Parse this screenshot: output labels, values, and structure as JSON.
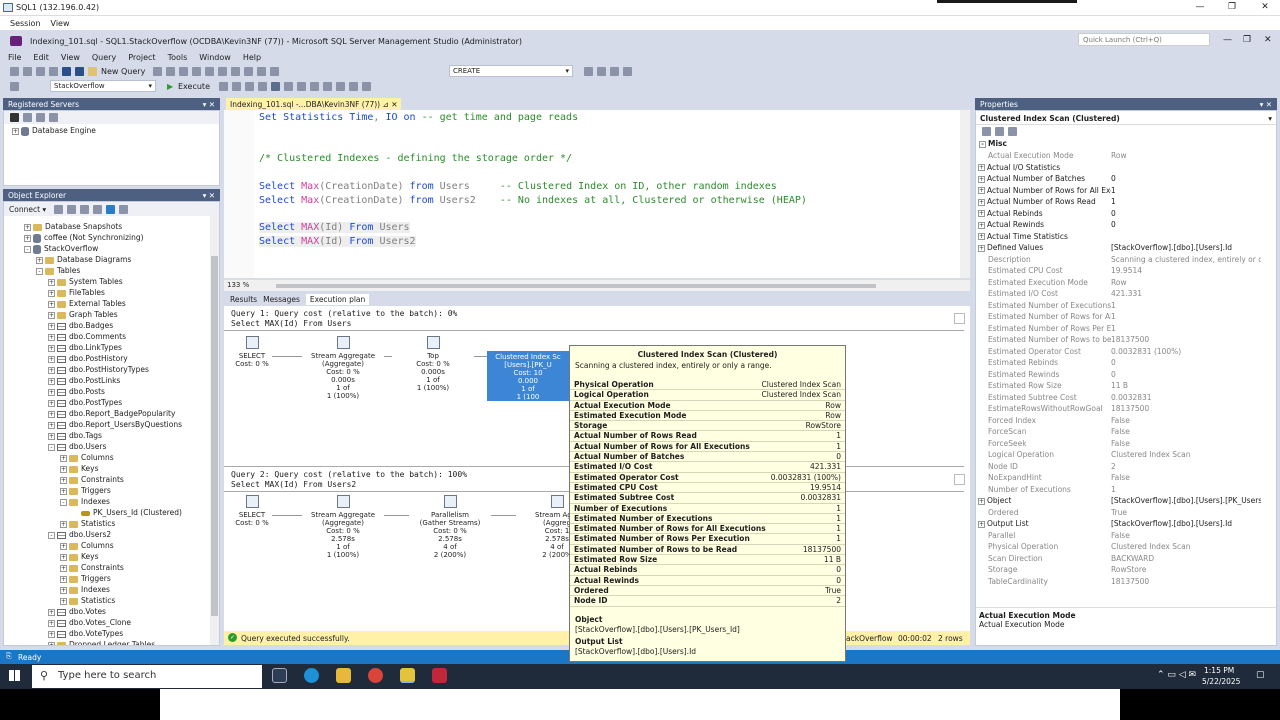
{
  "remote": {
    "title": "SQL1 (132.196.0.42)",
    "menu": [
      "Session",
      "View"
    ],
    "min": "—",
    "max": "❐",
    "close": "✕"
  },
  "ssms": {
    "title": "Indexing_101.sql - SQL1.StackOverflow (OCDBA\\Kevin3NF (77)) - Microsoft SQL Server Management Studio (Administrator)",
    "quick_launch_placeholder": "Quick Launch (Ctrl+Q)",
    "menu": [
      "File",
      "Edit",
      "View",
      "Query",
      "Project",
      "Tools",
      "Window",
      "Help"
    ],
    "new_query": "New Query",
    "execute": "Execute",
    "create_combo": "CREATE",
    "db_combo": "StackOverflow"
  },
  "registered_servers": {
    "header": "Registered Servers",
    "item": "Database Engine"
  },
  "object_explorer": {
    "header": "Object Explorer",
    "connect": "Connect ▾",
    "items": [
      {
        "label": "Database Snapshots",
        "indent": 2,
        "icon": "folder",
        "exp": "+"
      },
      {
        "label": "coffee (Not Synchronizing)",
        "indent": 2,
        "icon": "db",
        "exp": "+"
      },
      {
        "label": "StackOverflow",
        "indent": 2,
        "icon": "db",
        "exp": "-"
      },
      {
        "label": "Database Diagrams",
        "indent": 3,
        "icon": "folder",
        "exp": "+"
      },
      {
        "label": "Tables",
        "indent": 3,
        "icon": "folder",
        "exp": "-"
      },
      {
        "label": "System Tables",
        "indent": 4,
        "icon": "folder",
        "exp": "+"
      },
      {
        "label": "FileTables",
        "indent": 4,
        "icon": "folder",
        "exp": "+"
      },
      {
        "label": "External Tables",
        "indent": 4,
        "icon": "folder",
        "exp": "+"
      },
      {
        "label": "Graph Tables",
        "indent": 4,
        "icon": "folder",
        "exp": "+"
      },
      {
        "label": "dbo.Badges",
        "indent": 4,
        "icon": "table",
        "exp": "+"
      },
      {
        "label": "dbo.Comments",
        "indent": 4,
        "icon": "table",
        "exp": "+"
      },
      {
        "label": "dbo.LinkTypes",
        "indent": 4,
        "icon": "table",
        "exp": "+"
      },
      {
        "label": "dbo.PostHistory",
        "indent": 4,
        "icon": "table",
        "exp": "+"
      },
      {
        "label": "dbo.PostHistoryTypes",
        "indent": 4,
        "icon": "table",
        "exp": "+"
      },
      {
        "label": "dbo.PostLinks",
        "indent": 4,
        "icon": "table",
        "exp": "+"
      },
      {
        "label": "dbo.Posts",
        "indent": 4,
        "icon": "table",
        "exp": "+"
      },
      {
        "label": "dbo.PostTypes",
        "indent": 4,
        "icon": "table",
        "exp": "+"
      },
      {
        "label": "dbo.Report_BadgePopularity",
        "indent": 4,
        "icon": "table",
        "exp": "+"
      },
      {
        "label": "dbo.Report_UsersByQuestions",
        "indent": 4,
        "icon": "table",
        "exp": "+"
      },
      {
        "label": "dbo.Tags",
        "indent": 4,
        "icon": "table",
        "exp": "+"
      },
      {
        "label": "dbo.Users",
        "indent": 4,
        "icon": "table",
        "exp": "-"
      },
      {
        "label": "Columns",
        "indent": 5,
        "icon": "folder",
        "exp": "+"
      },
      {
        "label": "Keys",
        "indent": 5,
        "icon": "folder",
        "exp": "+"
      },
      {
        "label": "Constraints",
        "indent": 5,
        "icon": "folder",
        "exp": "+"
      },
      {
        "label": "Triggers",
        "indent": 5,
        "icon": "folder",
        "exp": "+"
      },
      {
        "label": "Indexes",
        "indent": 5,
        "icon": "folder",
        "exp": "-"
      },
      {
        "label": "PK_Users_Id (Clustered)",
        "indent": 6,
        "icon": "key",
        "exp": ""
      },
      {
        "label": "Statistics",
        "indent": 5,
        "icon": "folder",
        "exp": "+"
      },
      {
        "label": "dbo.Users2",
        "indent": 4,
        "icon": "table",
        "exp": "-"
      },
      {
        "label": "Columns",
        "indent": 5,
        "icon": "folder",
        "exp": "+"
      },
      {
        "label": "Keys",
        "indent": 5,
        "icon": "folder",
        "exp": "+"
      },
      {
        "label": "Constraints",
        "indent": 5,
        "icon": "folder",
        "exp": "+"
      },
      {
        "label": "Triggers",
        "indent": 5,
        "icon": "folder",
        "exp": "+"
      },
      {
        "label": "Indexes",
        "indent": 5,
        "icon": "folder",
        "exp": "+"
      },
      {
        "label": "Statistics",
        "indent": 5,
        "icon": "folder",
        "exp": "+"
      },
      {
        "label": "dbo.Votes",
        "indent": 4,
        "icon": "table",
        "exp": "+"
      },
      {
        "label": "dbo.Votes_Clone",
        "indent": 4,
        "icon": "table",
        "exp": "+"
      },
      {
        "label": "dbo.VoteTypes",
        "indent": 4,
        "icon": "table",
        "exp": "+"
      },
      {
        "label": "Dropped Ledger Tables",
        "indent": 4,
        "icon": "folder",
        "exp": "+"
      }
    ]
  },
  "editor": {
    "tab": "Indexing_101.sql -...DBA\\Kevin3NF (77))",
    "zoom": "133 %",
    "lines": [
      {
        "parts": [
          [
            "kw",
            "Set Statistics Time"
          ],
          [
            "gr",
            ", "
          ],
          [
            "kw",
            "IO on"
          ],
          [
            "cm",
            " -- get time and page reads"
          ]
        ]
      },
      {
        "parts": []
      },
      {
        "parts": []
      },
      {
        "parts": [
          [
            "cm",
            "/* Clustered Indexes - defining the storage order */"
          ]
        ]
      },
      {
        "parts": []
      },
      {
        "parts": [
          [
            "kw",
            "Select "
          ],
          [
            "fn",
            "Max"
          ],
          [
            "gr",
            "(CreationDate) "
          ],
          [
            "kw",
            "from "
          ],
          [
            "gr",
            "Users     "
          ],
          [
            "cm",
            "-- Clustered Index on ID, other random indexes"
          ]
        ]
      },
      {
        "parts": [
          [
            "kw",
            "Select "
          ],
          [
            "fn",
            "Max"
          ],
          [
            "gr",
            "(CreationDate) "
          ],
          [
            "kw",
            "from "
          ],
          [
            "gr",
            "Users2    "
          ],
          [
            "cm",
            "-- No indexes at all, Clustered or otherwise (HEAP)"
          ]
        ]
      },
      {
        "parts": []
      },
      {
        "parts": [
          [
            "kw",
            "Select "
          ],
          [
            "fn",
            "MAX"
          ],
          [
            "gr",
            "(Id) "
          ],
          [
            "kw",
            "From "
          ],
          [
            "gr",
            "Users"
          ]
        ]
      },
      {
        "parts": [
          [
            "kw",
            "Select "
          ],
          [
            "fn",
            "MAX"
          ],
          [
            "gr",
            "(Id) "
          ],
          [
            "kw",
            "From "
          ],
          [
            "gr",
            "Users2"
          ]
        ]
      }
    ]
  },
  "results_tabs": [
    "Results",
    "Messages",
    "Execution plan"
  ],
  "plan": {
    "q1_header": "Query 1: Query cost (relative to the batch): 0%",
    "q1_sql": "Select MAX(Id) From Users",
    "q2_header": "Query 2: Query cost (relative to the batch): 100%",
    "q2_sql": "Select MAX(Id) From Users2",
    "q1_nodes": [
      {
        "lines": [
          "SELECT",
          "Cost: 0 %"
        ]
      },
      {
        "lines": [
          "Stream Aggregate",
          "(Aggregate)",
          "Cost: 0 %",
          "0.000s",
          "1 of",
          "1 (100%)"
        ]
      },
      {
        "lines": [
          "Top",
          "Cost: 0 %",
          "0.000s",
          "1 of",
          "1 (100%)"
        ]
      },
      {
        "lines": [
          "Clustered Index Sc",
          "[Users].[PK_U",
          "Cost: 10",
          "0.000",
          "1 of",
          "1 (100"
        ]
      }
    ],
    "q2_nodes": [
      {
        "lines": [
          "SELECT",
          "Cost: 0 %"
        ]
      },
      {
        "lines": [
          "Stream Aggregate",
          "(Aggregate)",
          "Cost: 0 %",
          "2.578s",
          "1 of",
          "1 (100%)"
        ]
      },
      {
        "lines": [
          "Parallelism",
          "(Gather Streams)",
          "Cost: 0 %",
          "2.578s",
          "4 of",
          "2 (200%)"
        ]
      },
      {
        "lines": [
          "Stream Aggr",
          "(Aggreg",
          "Cost: 1",
          "2.578s",
          "4 of",
          "2 (200%"
        ]
      }
    ]
  },
  "tooltip": {
    "title": "Clustered Index Scan (Clustered)",
    "desc": "Scanning a clustered index, entirely or only a range.",
    "rows": [
      [
        "Physical Operation",
        "Clustered Index Scan"
      ],
      [
        "Logical Operation",
        "Clustered Index Scan"
      ],
      [
        "Actual Execution Mode",
        "Row"
      ],
      [
        "Estimated Execution Mode",
        "Row"
      ],
      [
        "Storage",
        "RowStore"
      ],
      [
        "Actual Number of Rows Read",
        "1"
      ],
      [
        "Actual Number of Rows for All Executions",
        "1"
      ],
      [
        "Actual Number of Batches",
        "0"
      ],
      [
        "Estimated I/O Cost",
        "421.331"
      ],
      [
        "Estimated Operator Cost",
        "0.0032831 (100%)"
      ],
      [
        "Estimated CPU Cost",
        "19.9514"
      ],
      [
        "Estimated Subtree Cost",
        "0.0032831"
      ],
      [
        "Number of Executions",
        "1"
      ],
      [
        "Estimated Number of Executions",
        "1"
      ],
      [
        "Estimated Number of Rows for All Executions",
        "1"
      ],
      [
        "Estimated Number of Rows Per Execution",
        "1"
      ],
      [
        "Estimated Number of Rows to be Read",
        "18137500"
      ],
      [
        "Estimated Row Size",
        "11 B"
      ],
      [
        "Actual Rebinds",
        "0"
      ],
      [
        "Actual Rewinds",
        "0"
      ],
      [
        "Ordered",
        "True"
      ],
      [
        "Node ID",
        "2"
      ]
    ],
    "object_label": "Object",
    "object_value": "[StackOverflow].[dbo].[Users].[PK_Users_Id]",
    "output_label": "Output List",
    "output_value": "[StackOverflow].[dbo].[Users].Id"
  },
  "query_status": {
    "text": "Query executed successfully.",
    "db": "ackOverflow",
    "time": "00:00:02",
    "rows": "2 rows"
  },
  "status_bar": "Ready",
  "properties": {
    "header": "Properties",
    "object": "Clustered Index Scan (Clustered)",
    "section": "Misc",
    "rows": [
      {
        "k": "Actual Execution Mode",
        "v": "Row",
        "exp": "",
        "gray": true
      },
      {
        "k": "Actual I/O Statistics",
        "v": "",
        "exp": "+",
        "gray": false
      },
      {
        "k": "Actual Number of Batches",
        "v": "0",
        "exp": "+",
        "gray": false
      },
      {
        "k": "Actual Number of Rows for All Execut",
        "v": "1",
        "exp": "+",
        "gray": false
      },
      {
        "k": "Actual Number of Rows Read",
        "v": "1",
        "exp": "+",
        "gray": false
      },
      {
        "k": "Actual Rebinds",
        "v": "0",
        "exp": "+",
        "gray": false
      },
      {
        "k": "Actual Rewinds",
        "v": "0",
        "exp": "+",
        "gray": false
      },
      {
        "k": "Actual Time Statistics",
        "v": "",
        "exp": "+",
        "gray": false
      },
      {
        "k": "Defined Values",
        "v": "[StackOverflow].[dbo].[Users].Id",
        "exp": "+",
        "gray": false
      },
      {
        "k": "Description",
        "v": "Scanning a clustered index, entirely or only",
        "exp": "",
        "gray": true
      },
      {
        "k": "Estimated CPU Cost",
        "v": "19.9514",
        "exp": "",
        "gray": true
      },
      {
        "k": "Estimated Execution Mode",
        "v": "Row",
        "exp": "",
        "gray": true
      },
      {
        "k": "Estimated I/O Cost",
        "v": "421.331",
        "exp": "",
        "gray": true
      },
      {
        "k": "Estimated Number of Executions",
        "v": "1",
        "exp": "",
        "gray": true
      },
      {
        "k": "Estimated Number of Rows for All Ex",
        "v": "1",
        "exp": "",
        "gray": true
      },
      {
        "k": "Estimated Number of Rows Per Execu",
        "v": "1",
        "exp": "",
        "gray": true
      },
      {
        "k": "Estimated Number of Rows to be Read",
        "v": "18137500",
        "exp": "",
        "gray": true
      },
      {
        "k": "Estimated Operator Cost",
        "v": "0.0032831 (100%)",
        "exp": "",
        "gray": true
      },
      {
        "k": "Estimated Rebinds",
        "v": "0",
        "exp": "",
        "gray": true
      },
      {
        "k": "Estimated Rewinds",
        "v": "0",
        "exp": "",
        "gray": true
      },
      {
        "k": "Estimated Row Size",
        "v": "11 B",
        "exp": "",
        "gray": true
      },
      {
        "k": "Estimated Subtree Cost",
        "v": "0.0032831",
        "exp": "",
        "gray": true
      },
      {
        "k": "EstimateRowsWithoutRowGoal",
        "v": "18137500",
        "exp": "",
        "gray": true
      },
      {
        "k": "Forced Index",
        "v": "False",
        "exp": "",
        "gray": true
      },
      {
        "k": "ForceScan",
        "v": "False",
        "exp": "",
        "gray": true
      },
      {
        "k": "ForceSeek",
        "v": "False",
        "exp": "",
        "gray": true
      },
      {
        "k": "Logical Operation",
        "v": "Clustered Index Scan",
        "exp": "",
        "gray": true
      },
      {
        "k": "Node ID",
        "v": "2",
        "exp": "",
        "gray": true
      },
      {
        "k": "NoExpandHint",
        "v": "False",
        "exp": "",
        "gray": true
      },
      {
        "k": "Number of Executions",
        "v": "1",
        "exp": "",
        "gray": true
      },
      {
        "k": "Object",
        "v": "[StackOverflow].[dbo].[Users].[PK_Users_Id]",
        "exp": "+",
        "gray": false
      },
      {
        "k": "Ordered",
        "v": "True",
        "exp": "",
        "gray": true
      },
      {
        "k": "Output List",
        "v": "[StackOverflow].[dbo].[Users].Id",
        "exp": "+",
        "gray": false
      },
      {
        "k": "Parallel",
        "v": "False",
        "exp": "",
        "gray": true
      },
      {
        "k": "Physical Operation",
        "v": "Clustered Index Scan",
        "exp": "",
        "gray": true
      },
      {
        "k": "Scan Direction",
        "v": "BACKWARD",
        "exp": "",
        "gray": true
      },
      {
        "k": "Storage",
        "v": "RowStore",
        "exp": "",
        "gray": true
      },
      {
        "k": "TableCardinality",
        "v": "18137500",
        "exp": "",
        "gray": true
      }
    ],
    "desc_title": "Actual Execution Mode",
    "desc_text": "Actual Execution Mode"
  },
  "taskbar": {
    "search_placeholder": "Type here to search",
    "time": "1:15 PM",
    "date": "5/22/2025"
  },
  "colors": {
    "accent": "#1c76c6",
    "panel_header": "#4d6082",
    "tooltip_bg": "#ffffe1",
    "selected_node": "#3d86d6"
  }
}
